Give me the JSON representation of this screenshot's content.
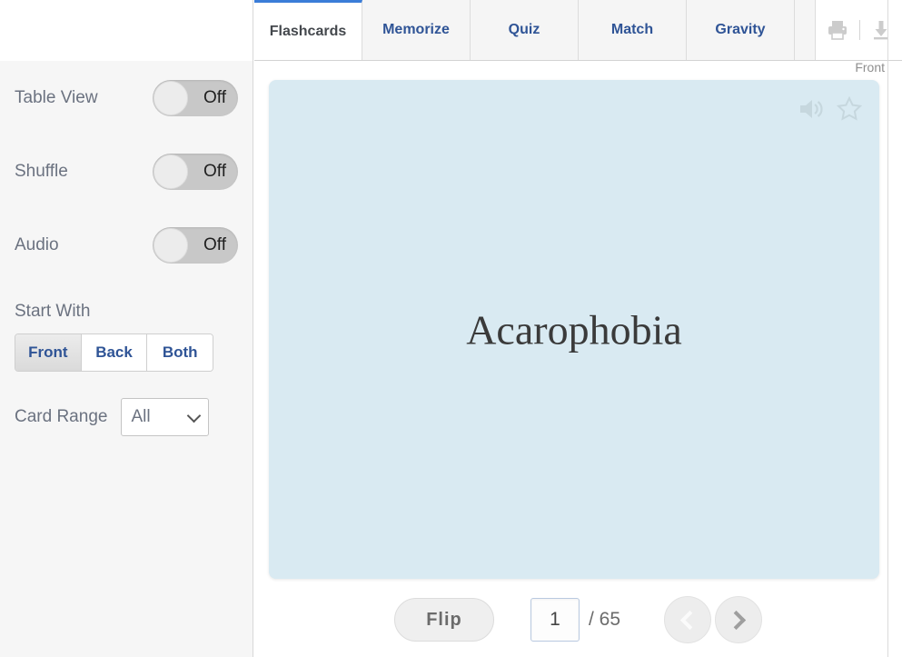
{
  "sidebar": {
    "settings": [
      {
        "label": "Table View",
        "state": "Off",
        "name": "table-view"
      },
      {
        "label": "Shuffle",
        "state": "Off",
        "name": "shuffle"
      },
      {
        "label": "Audio",
        "state": "Off",
        "name": "audio"
      }
    ],
    "start_with": {
      "title": "Start With",
      "options": [
        {
          "label": "Front",
          "selected": true
        },
        {
          "label": "Back",
          "selected": false
        },
        {
          "label": "Both",
          "selected": false
        }
      ]
    },
    "card_range": {
      "label": "Card Range",
      "value": "All",
      "options": [
        "All"
      ],
      "chevron_icon": "chevron-down-icon"
    }
  },
  "tabs": [
    {
      "label": "Flashcards",
      "active": true
    },
    {
      "label": "Memorize",
      "active": false
    },
    {
      "label": "Quiz",
      "active": false
    },
    {
      "label": "Match",
      "active": false
    },
    {
      "label": "Gravity",
      "active": false
    }
  ],
  "tab_actions": {
    "print_icon": "print-icon",
    "download_icon": "download-icon"
  },
  "card": {
    "side_label": "Front",
    "text": "Acarophobia",
    "background_color": "#d9eaf2",
    "audio_icon": "speaker-icon",
    "star_icon": "star-icon"
  },
  "controls": {
    "flip_label": "Flip",
    "current_page": "1",
    "page_total": "/ 65",
    "prev_icon": "chevron-left-icon",
    "next_icon": "chevron-right-icon"
  },
  "colors": {
    "tab_link": "#2f5496",
    "active_tab_accent": "#3b7dd8",
    "card_bg": "#d9eaf2",
    "sidebar_bg": "#f6f6f6"
  }
}
